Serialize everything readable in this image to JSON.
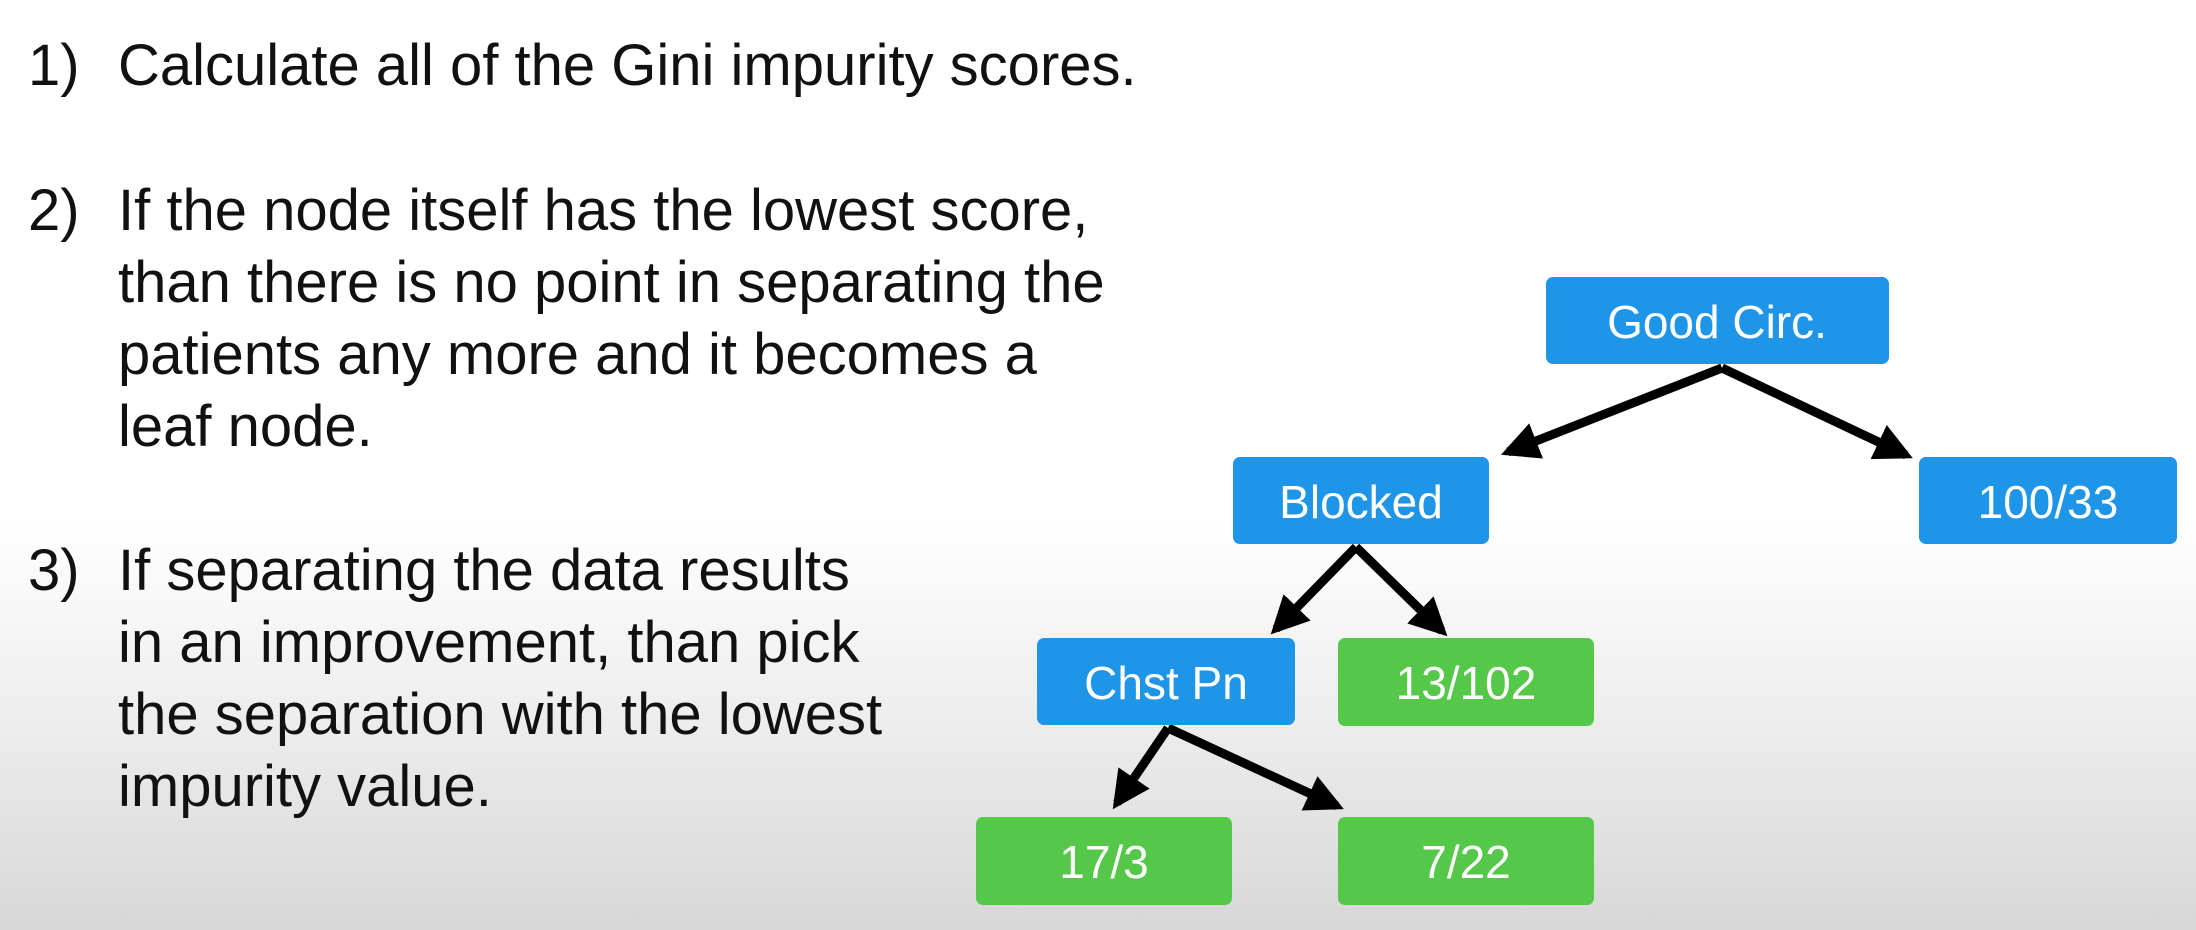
{
  "steps": [
    {
      "number": "1)",
      "lines": [
        "Calculate all of the Gini impurity scores."
      ]
    },
    {
      "number": "2)",
      "lines": [
        "If the node itself has the lowest score,",
        "than there is no point in separating the",
        "patients any more and it becomes a",
        "leaf node."
      ]
    },
    {
      "number": "3)",
      "lines": [
        "If separating the data results",
        "in an improvement, than pick",
        "the separation with the lowest",
        "impurity value."
      ]
    }
  ],
  "tree": {
    "colors": {
      "decision": "#1f95e8",
      "leaf_pure": "#55c849",
      "arrow": "#000000"
    },
    "nodes": {
      "good_circ": {
        "label": "Good Circ.",
        "kind": "decision"
      },
      "blocked": {
        "label": "Blocked",
        "kind": "decision"
      },
      "right_leaf": {
        "label": "100/33",
        "kind": "decision"
      },
      "chst_pn": {
        "label": "Chst Pn",
        "kind": "decision"
      },
      "blocked_leaf": {
        "label": "13/102",
        "kind": "leaf"
      },
      "leaf_left": {
        "label": "17/3",
        "kind": "leaf"
      },
      "leaf_right": {
        "label": "7/22",
        "kind": "leaf"
      }
    }
  }
}
